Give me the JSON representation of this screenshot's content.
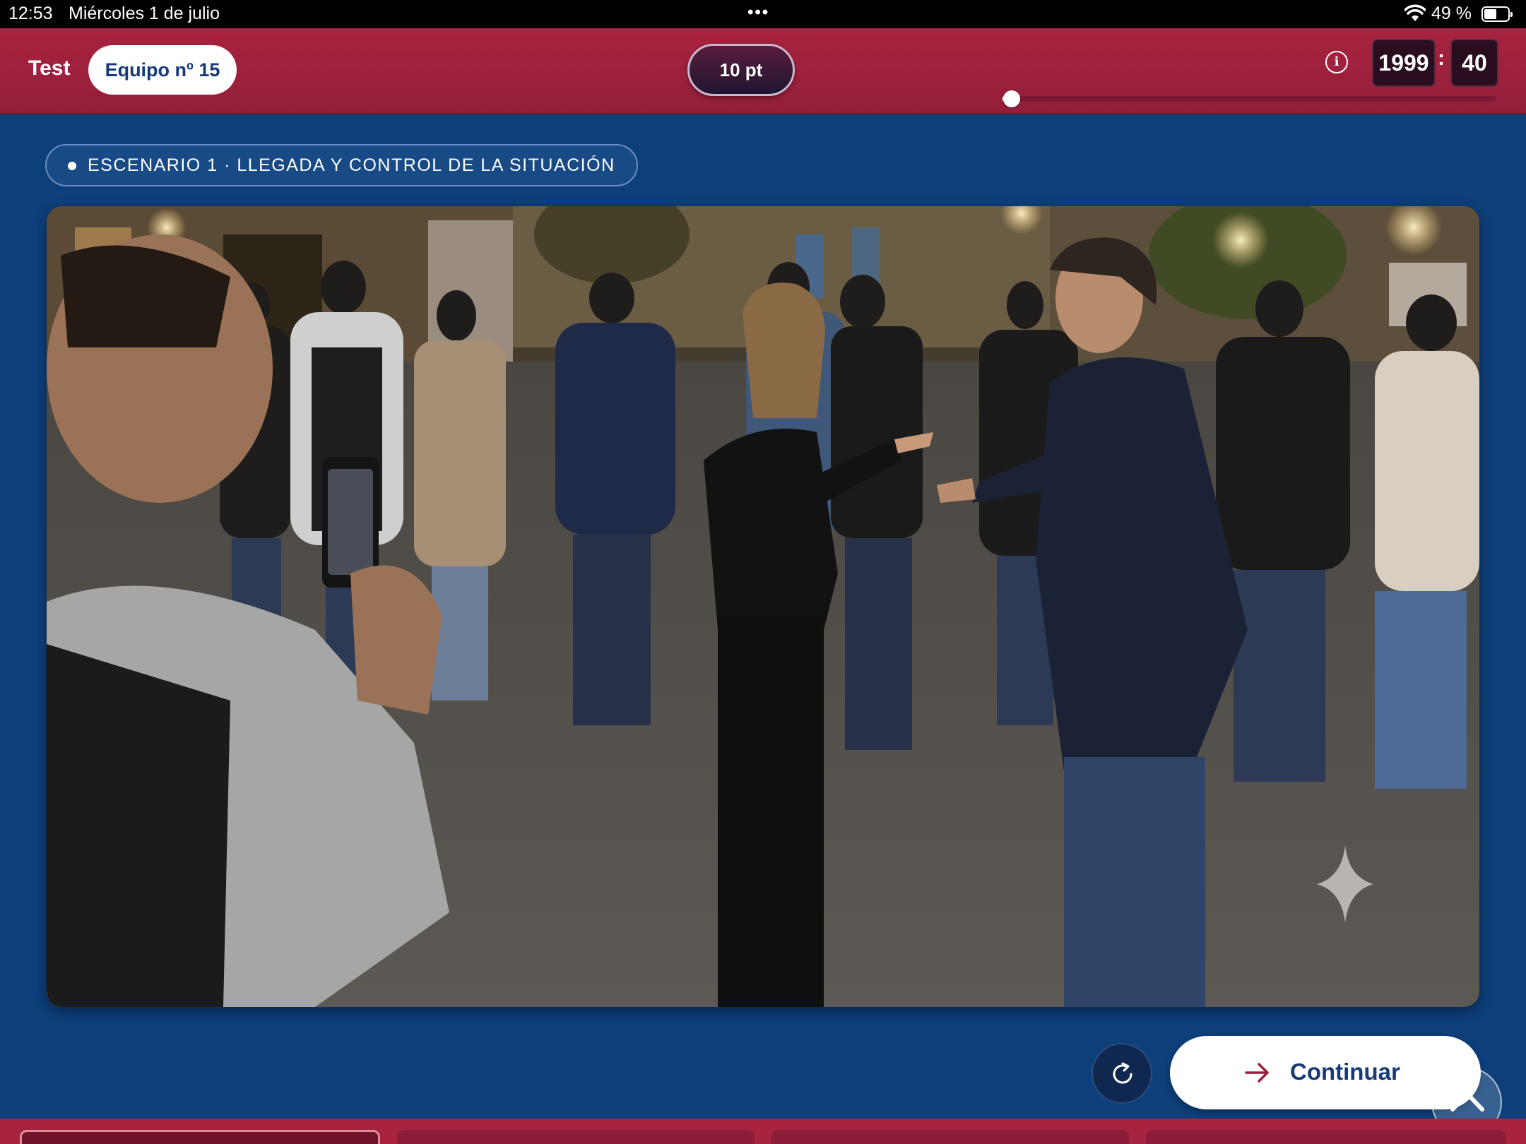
{
  "status_bar": {
    "time": "12:53",
    "date": "Miércoles 1 de julio",
    "dots": "•••",
    "battery_percent": "49 %",
    "battery_level": 0.49,
    "wifi_icon": "wifi-icon",
    "battery_icon": "battery-icon"
  },
  "header": {
    "test_label": "Test",
    "team_label": "Equipo nº 15",
    "points_label": "10 pt",
    "info_icon": "info-icon",
    "info_glyph": "i",
    "year": "1999",
    "colon": ":",
    "seconds": "40",
    "progress": 0.02,
    "colors": {
      "header_bg": "#a8233f",
      "page_bg": "#0d3f7a",
      "accent_text": "#173a78"
    }
  },
  "scenario": {
    "label": "ESCENARIO 1 · LLEGADA Y CONTROL DE LA SITUACIÓN"
  },
  "scene": {
    "icon": "sparkle-icon"
  },
  "actions": {
    "reload_icon": "refresh-icon",
    "continue_icon": "arrow-right-icon",
    "continue_label": "Continuar",
    "scroll_top_icon": "chevron-up-icon"
  }
}
